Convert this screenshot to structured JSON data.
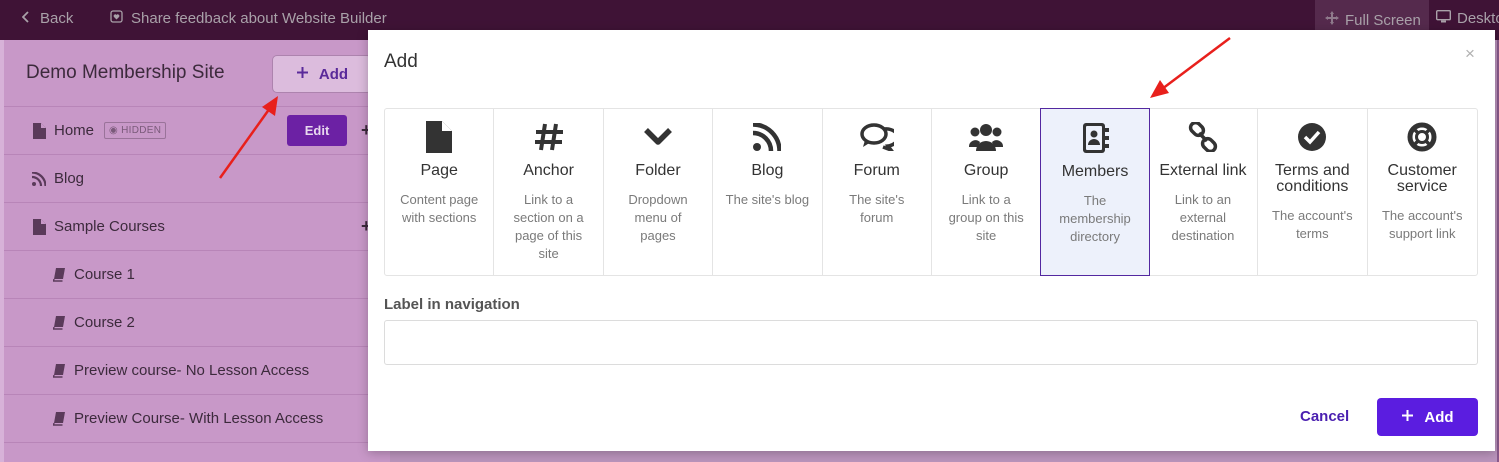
{
  "topbar": {
    "back_label": "Back",
    "feedback_label": "Share feedback about Website Builder",
    "fullscreen_label": "Full Screen",
    "desktop_label": "Deskto"
  },
  "sidebar": {
    "site_title": "Demo Membership Site",
    "add_label": "Add",
    "edit_label": "Edit",
    "hidden_badge": "HIDDEN",
    "items": [
      {
        "label": "Home",
        "icon": "page-icon"
      },
      {
        "label": "Blog",
        "icon": "rss-icon"
      },
      {
        "label": "Sample Courses",
        "icon": "page-icon"
      },
      {
        "label": "Course 1",
        "icon": "book-icon"
      },
      {
        "label": "Course 2",
        "icon": "book-icon"
      },
      {
        "label": "Preview course- No Lesson Access",
        "icon": "book-icon"
      },
      {
        "label": "Preview Course- With Lesson Access",
        "icon": "book-icon"
      }
    ]
  },
  "modal": {
    "title": "Add",
    "close": "×",
    "selected_type": "Members",
    "types": [
      {
        "name": "Page",
        "desc": "Content page with sections",
        "icon": "page-icon"
      },
      {
        "name": "Anchor",
        "desc": "Link to a section on a page of this site",
        "icon": "hash-icon"
      },
      {
        "name": "Folder",
        "desc": "Dropdown menu of pages",
        "icon": "chevron-down-icon"
      },
      {
        "name": "Blog",
        "desc": "The site's blog",
        "icon": "rss-icon"
      },
      {
        "name": "Forum",
        "desc": "The site's forum",
        "icon": "comments-icon"
      },
      {
        "name": "Group",
        "desc": "Link to a group on this site",
        "icon": "users-icon"
      },
      {
        "name": "Members",
        "desc": "The membership directory",
        "icon": "address-book-icon"
      },
      {
        "name": "External link",
        "desc": "Link to an external destination",
        "icon": "link-icon"
      },
      {
        "name": "Terms and conditions",
        "desc": "The account's terms",
        "icon": "check-circle-icon"
      },
      {
        "name": "Customer service",
        "desc": "The account's support link",
        "icon": "lifering-icon"
      }
    ],
    "field_label": "Label in navigation",
    "field_value": "",
    "cancel_label": "Cancel",
    "add_label": "Add"
  },
  "colors": {
    "accent": "#5b1de0",
    "selected_border": "#5328a0",
    "annotation_arrow": "#e8201c"
  }
}
